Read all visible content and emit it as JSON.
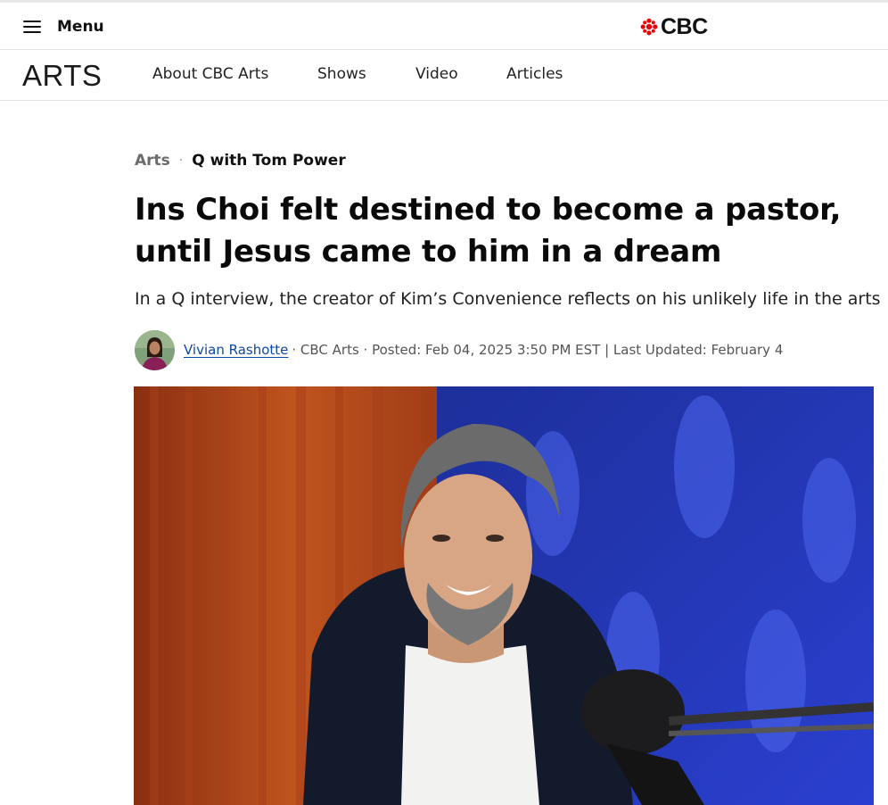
{
  "header": {
    "menu_label": "Menu",
    "brand": "CBC",
    "brand_color": "#e60505"
  },
  "section": {
    "title": "ARTS",
    "nav": [
      {
        "label": "About CBC Arts"
      },
      {
        "label": "Shows"
      },
      {
        "label": "Video"
      },
      {
        "label": "Articles"
      }
    ]
  },
  "article": {
    "category": "Arts",
    "separator": "·",
    "show": "Q with Tom Power",
    "headline": "Ins Choi felt destined to become a pastor, until Jesus came to him in a dream",
    "deck": "In a Q interview, the creator of Kim’s Convenience reflects on his unlikely life in the arts",
    "author": "Vivian Rashotte",
    "meta": "· CBC Arts · Posted: Feb 04, 2025 3:50 PM EST | Last Updated: February 4"
  },
  "icons": {
    "menu": "hamburger-icon",
    "brand": "cbc-gem-icon"
  }
}
